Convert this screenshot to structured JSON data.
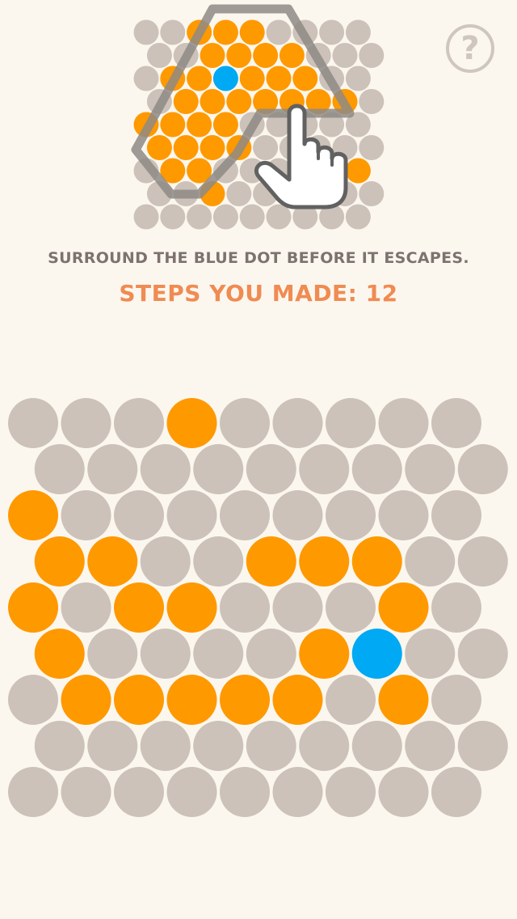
{
  "help": {
    "label": "?",
    "icon": "question-mark-icon"
  },
  "instruction": "SURROUND THE BLUE DOT BEFORE IT ESCAPES.",
  "steps": {
    "label": "STEPS YOU MADE: 12",
    "count": 12
  },
  "colors": {
    "background": "#FBF7EF",
    "empty": "#CCC2B9",
    "blocked": "#FF9900",
    "dot": "#00A9F4",
    "instruction_text": "#7D7270",
    "steps_text": "#F08B52",
    "help_icon": "#CFC6BD",
    "outline": "#8E8985"
  },
  "tutorial": {
    "description_icons": [
      "hand-pointer-icon",
      "hex-outline"
    ],
    "board": [
      "..OOO....",
      "..OOOO...",
      ".OOBOOO..",
      ".OOOOOOO.",
      "OOOO.....",
      "OOOO.....",
      ".OO.....O",
      "..O......",
      "........."
    ]
  },
  "board": {
    "rows": 9,
    "cols": 9,
    "legend": {
      ".": "empty",
      "O": "blocked",
      "B": "blue-dot"
    },
    "cells": [
      "...O.....",
      ".........",
      "O........",
      "OO..OOO..",
      "O.OO...O.",
      "O....OB..",
      ".OOOOO.O.",
      ".........",
      "........."
    ]
  }
}
